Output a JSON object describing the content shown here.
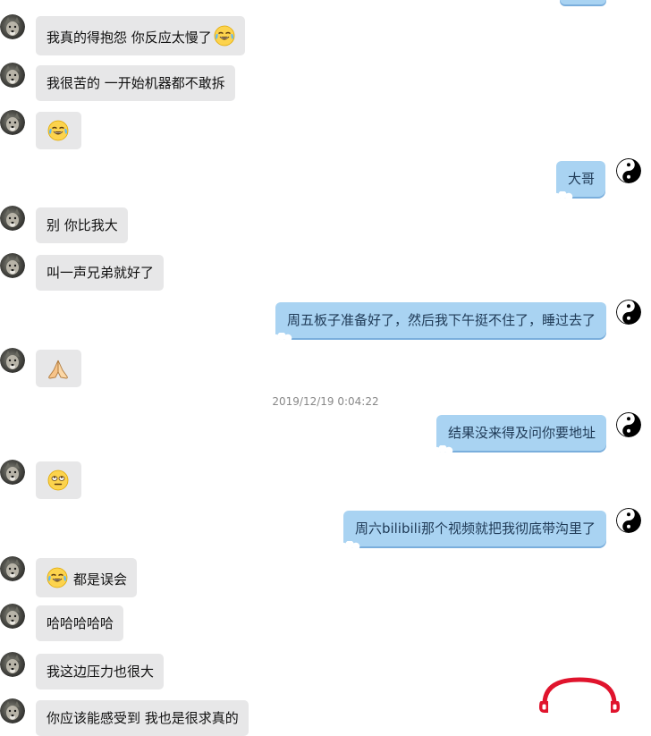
{
  "messages": [
    {
      "id": 1,
      "side": "left",
      "text": "我真的得抱怨 你反应太慢了",
      "emoji_after": "tears-of-joy"
    },
    {
      "id": 2,
      "side": "left",
      "text": "我很苦的 一开始机器都不敢拆"
    },
    {
      "id": 3,
      "side": "left",
      "text": "",
      "emoji_only": "tears-of-joy"
    },
    {
      "id": 4,
      "side": "right",
      "text": "大哥"
    },
    {
      "id": 5,
      "side": "left",
      "text": "别 你比我大"
    },
    {
      "id": 6,
      "side": "left",
      "text": "叫一声兄弟就好了"
    },
    {
      "id": 7,
      "side": "right",
      "text": "周五板子准备好了，然后我下午挺不住了，睡过去了"
    },
    {
      "id": 8,
      "side": "left",
      "text": "",
      "emoji_only": "folded-hands"
    },
    {
      "id": 9,
      "side": "right",
      "text": "结果没来得及问你要地址"
    },
    {
      "id": 10,
      "side": "left",
      "text": "",
      "emoji_only": "rolling-eyes"
    },
    {
      "id": 11,
      "side": "right",
      "text": "周六bilibili那个视频就把我彻底带沟里了"
    },
    {
      "id": 12,
      "side": "left",
      "text": "都是误会",
      "emoji_before": "tears-of-joy"
    },
    {
      "id": 13,
      "side": "left",
      "text": "哈哈哈哈哈"
    },
    {
      "id": 14,
      "side": "left",
      "text": "我这边压力也很大"
    },
    {
      "id": 15,
      "side": "left",
      "text": "你应该能感受到 我也是很求真的"
    }
  ],
  "timestamp": "2019/12/19 0:04:22",
  "avatars": {
    "left": "wolf-avatar",
    "right": "yin-yang-avatar"
  },
  "colors": {
    "left_bubble": "#e7e7e8",
    "right_bubble": "#a9d3f2",
    "right_bubble_shadow": "#7aaedc",
    "right_text": "#1f3a56",
    "timestamp_text": "#888888",
    "logo": "#e0142d"
  },
  "icons": {
    "watermark": "headphones-logo-icon"
  }
}
